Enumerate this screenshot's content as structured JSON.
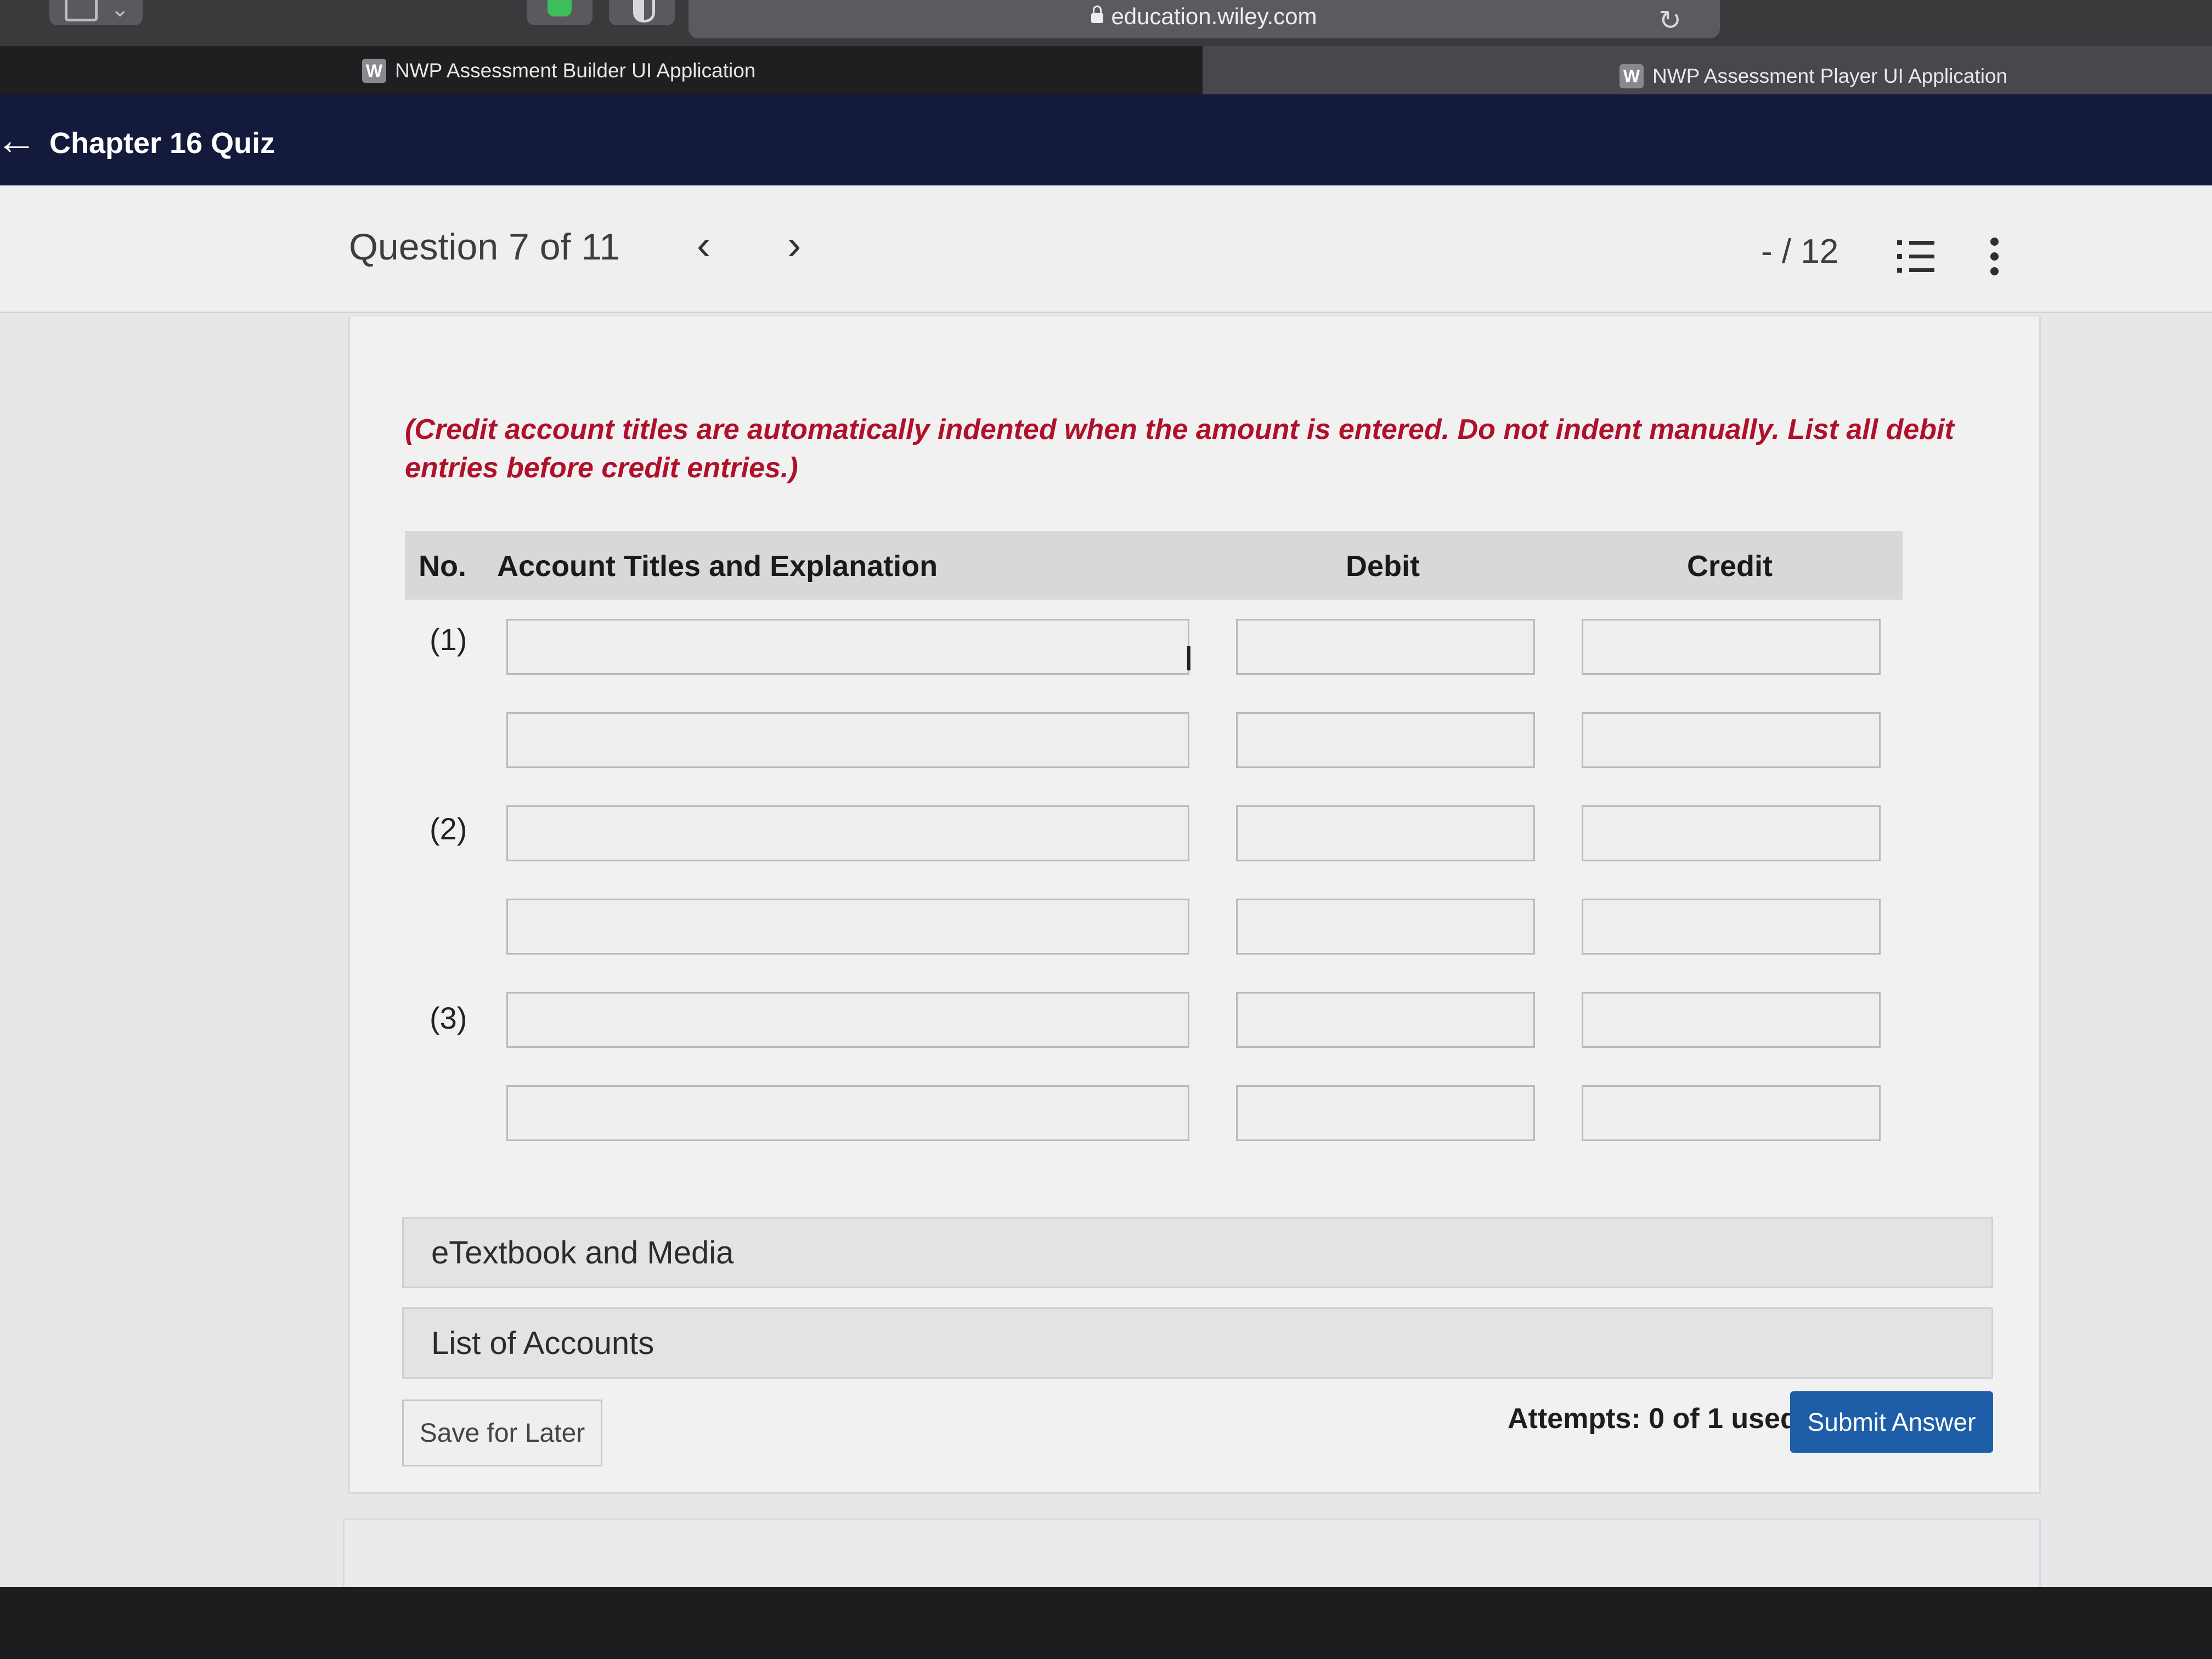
{
  "browser": {
    "url": "education.wiley.com",
    "tabs": [
      {
        "favicon": "W",
        "label": "NWP Assessment Builder UI Application"
      },
      {
        "favicon": "W",
        "label": "NWP Assessment Player UI Application"
      }
    ],
    "icons": [
      "sidebar-toggle-icon",
      "extension-icon",
      "shield-icon",
      "lock-icon",
      "reload-icon"
    ]
  },
  "header": {
    "back_icon": "back-arrow-icon",
    "title": "Chapter 16 Quiz"
  },
  "question_bar": {
    "counter": "Question 7 of 11",
    "prev_icon": "chevron-left-icon",
    "next_icon": "chevron-right-icon",
    "score": "- / 12",
    "list_icon": "numbered-list-icon",
    "more_icon": "more-vertical-icon"
  },
  "question": {
    "instructions": "(Credit account titles are automatically indented when the amount is entered. Do not indent manually. List all debit entries before credit entries.)",
    "columns": {
      "no": "No.",
      "account": "Account Titles and Explanation",
      "debit": "Debit",
      "credit": "Credit"
    },
    "entries": [
      {
        "no": "(1)",
        "lines": [
          {
            "account": "",
            "debit": "",
            "credit": ""
          },
          {
            "account": "",
            "debit": "",
            "credit": ""
          }
        ]
      },
      {
        "no": "(2)",
        "lines": [
          {
            "account": "",
            "debit": "",
            "credit": ""
          },
          {
            "account": "",
            "debit": "",
            "credit": ""
          }
        ]
      },
      {
        "no": "(3)",
        "lines": [
          {
            "account": "",
            "debit": "",
            "credit": ""
          },
          {
            "account": "",
            "debit": "",
            "credit": ""
          }
        ]
      }
    ]
  },
  "resources": {
    "etextbook": "eTextbook and Media",
    "list_of_accounts": "List of Accounts"
  },
  "footer": {
    "save_label": "Save for Later",
    "attempts": "Attempts: 0 of 1 used",
    "submit_label": "Submit Answer"
  },
  "colors": {
    "header_bg": "#141a3b",
    "instruction_text": "#b0112a",
    "submit_bg": "#1e5da8"
  }
}
